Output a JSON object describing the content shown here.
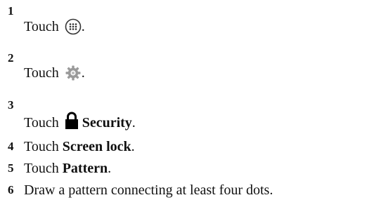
{
  "steps": [
    {
      "number": "1",
      "prefix": "Touch",
      "icon": "apps-grid-icon",
      "suffix": "."
    },
    {
      "number": "2",
      "prefix": "Touch",
      "icon": "settings-gear-icon",
      "suffix": "."
    },
    {
      "number": "3",
      "prefix": "Touch",
      "icon": "lock-icon",
      "bold": "Security",
      "suffix": "."
    },
    {
      "number": "4",
      "prefix": "Touch",
      "bold": "Screen lock",
      "suffix": "."
    },
    {
      "number": "5",
      "prefix": "Touch",
      "bold": "Pattern",
      "suffix": "."
    },
    {
      "number": "6",
      "text": "Draw a pattern connecting at least four dots."
    }
  ]
}
